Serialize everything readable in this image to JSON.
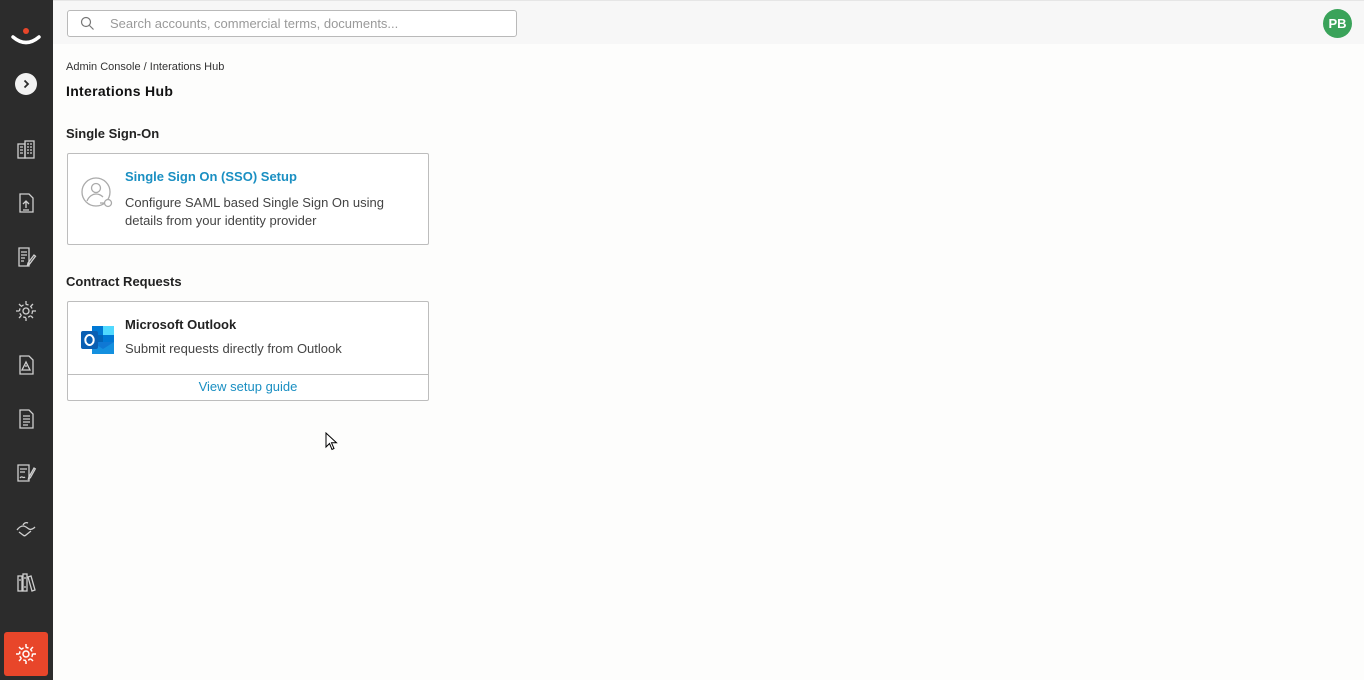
{
  "search": {
    "placeholder": "Search accounts, commercial terms, documents..."
  },
  "user": {
    "initials": "PB",
    "avatar_color": "#3aa35a"
  },
  "sidebar": {
    "items": [
      {
        "icon": "building-icon"
      },
      {
        "icon": "document-upload-icon"
      },
      {
        "icon": "document-edit-icon"
      },
      {
        "icon": "gear-network-icon"
      },
      {
        "icon": "document-alert-icon"
      },
      {
        "icon": "document-list-icon"
      },
      {
        "icon": "signature-icon"
      },
      {
        "icon": "handshake-icon"
      },
      {
        "icon": "books-icon"
      },
      {
        "icon": "admin-gear-icon",
        "active": true
      }
    ],
    "accent": "#e8462a"
  },
  "breadcrumb": "Admin Console / Interations Hub",
  "page_title": "Interations Hub",
  "sections": {
    "sso": {
      "title": "Single Sign-On",
      "card": {
        "title": "Single Sign On (SSO) Setup",
        "description": "Configure SAML based Single Sign On using details from your identity provider",
        "icon": "user-key-icon"
      }
    },
    "contract_requests": {
      "title": "Contract Requests",
      "card": {
        "title": "Microsoft Outlook",
        "description": "Submit requests directly from Outlook",
        "icon": "outlook-icon",
        "footer_link": "View setup guide"
      }
    }
  },
  "link_color": "#1a8fc2"
}
